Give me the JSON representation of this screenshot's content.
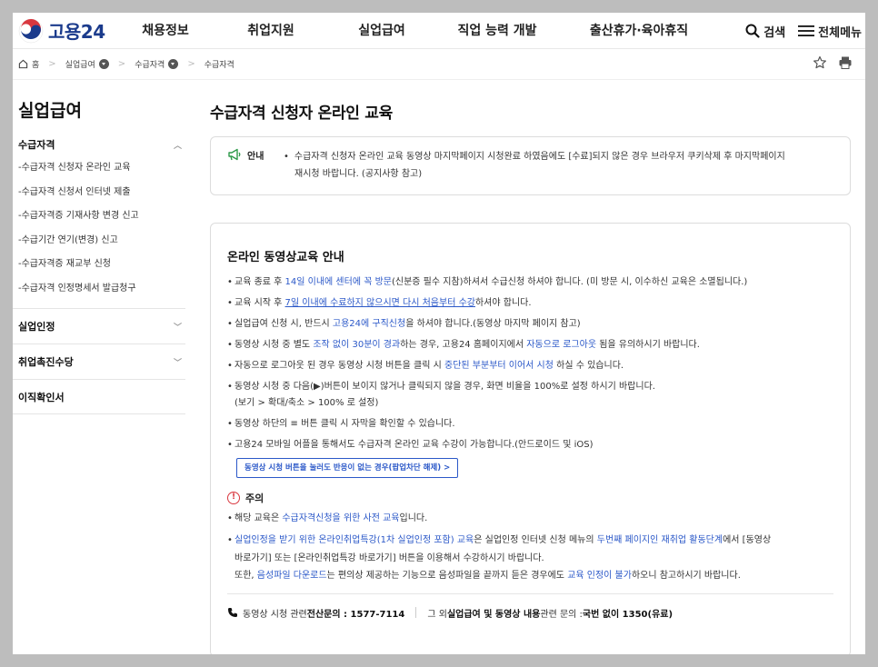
{
  "header": {
    "logo_text": "고용24",
    "nav": [
      "채용정보",
      "취업지원",
      "실업급여",
      "직업 능력 개발",
      "출산휴가·육아휴직"
    ],
    "search_label": "검색",
    "menu_label": "전체메뉴"
  },
  "breadcrumb": {
    "home": "홈",
    "items": [
      "실업급여",
      "수급자격",
      "수급자격"
    ]
  },
  "sidebar": {
    "title": "실업급여",
    "groups": [
      {
        "label": "수급자격",
        "items": [
          "수급자격 신청자 온라인 교육",
          "수급자격 신청서 인터넷 제출",
          "수급자격증 기재사항 변경 신고",
          "수급기간 연기(변경) 신고",
          "수급자격증 재교부 신청",
          "수급자격 인정명세서 발급청구"
        ]
      },
      {
        "label": "실업인정"
      },
      {
        "label": "취업촉진수당"
      },
      {
        "label": "이직확인서"
      }
    ]
  },
  "main": {
    "title": "수급자격 신청자 온라인 교육",
    "notice": {
      "label": "안내",
      "text_line1": "수급자격 신청자 온라인 교육 동영상 마지막페이지 시청완료 하였음에도 [수료]되지 않은 경우 브라우저 쿠키삭제 후 마지막페이지",
      "text_line2": "재시청 바랍니다. (공지사항 참고)"
    },
    "card": {
      "title": "온라인 동영상교육 안내",
      "b1": {
        "a": "교육 종료 후 ",
        "b": "14일 이내에 센터에 꼭 방문",
        "c": "(신분증 필수 지참)하셔서 수급신청 하셔야 합니다. (미 방문 시, 이수하신 교육은 소멸됩니다.)"
      },
      "b2": {
        "a": "교육 시작 후 ",
        "b": "7일 이내에 수료하지 않으시면 다시 처음부터 수강",
        "c": "하셔야 합니다."
      },
      "b3": {
        "a": "실업급여 신청 시, 반드시 ",
        "b": "고용24에 구직신청",
        "c": "을 하셔야 합니다.(동영상 마지막 페이지 참고)"
      },
      "b4": {
        "a": "동영상 시청 중 별도 ",
        "b": "조작 없이 30분이 경과",
        "c": "하는 경우, 고용24 홈페이지에서 ",
        "d": "자동으로 로그아웃",
        "e": " 됨을 유의하시기 바랍니다."
      },
      "b5": {
        "a": "자동으로 로그아웃 된 경우 동영상 시청 버튼을 클릭 시 ",
        "b": "중단된 부분부터 이어서 시청",
        "c": " 하실 수 있습니다."
      },
      "b6": {
        "line1": "동영상 시청 중 다음(▶)버튼이 보이지 않거나 클릭되지 않을 경우, 화면 비율을 100%로 설정 하시기 바랍니다.",
        "line2": "(보기 > 확대/축소 > 100% 로 설정)"
      },
      "b7": "동영상 하단의 ≡ 버튼 클릭 시 자막을 확인할 수 있습니다.",
      "b8": "고용24 모바일 어플을 통해서도 수급자격 온라인 교육 수강이 가능합니다.(안드로이드 및 iOS)",
      "popup_button": "동영상 시청 버튼을 눌러도 반응이 없는 경우(팝업차단 해제) >",
      "caution_label": "주의",
      "c1": {
        "a": "해당 교육은 ",
        "b": "수급자격신청을 위한 사전 교육",
        "c": "입니다."
      },
      "c2": {
        "a": "실업인정을 받기 위한 온라인취업특강(1차 실업인정 포함) 교육",
        "b": "은 실업인정 인터넷 신청 메뉴의 ",
        "c": "두번째 페이지인 재취업 활동단계",
        "d": "에서 [동영상",
        "line2": "바로가기] 또는 [온라인취업특강 바로가기] 버튼을 이용해서 수강하시기 바랍니다.",
        "line3a": "또한, ",
        "line3b": "음성파일 다운로드",
        "line3c": "는 편의상 제공하는 기능으로 음성파일을 끝까지 듣은 경우에도 ",
        "line3d": "교육 인정이 불가",
        "line3e": "하오니 참고하시기 바랍니다."
      },
      "footer": {
        "left_a": "동영상 시청 관련 ",
        "left_b": "전산문의 : 1577-7114",
        "right_a": "그 외 ",
        "right_b": "실업급여 및 동영상 내용",
        "right_c": " 관련 문의 : ",
        "right_d": "국번 없이 1350(유료)"
      }
    }
  },
  "colors": {
    "accent_blue": "#2b58c8",
    "warning_red": "#d9373f",
    "logo_navy": "#1b3b8c"
  }
}
